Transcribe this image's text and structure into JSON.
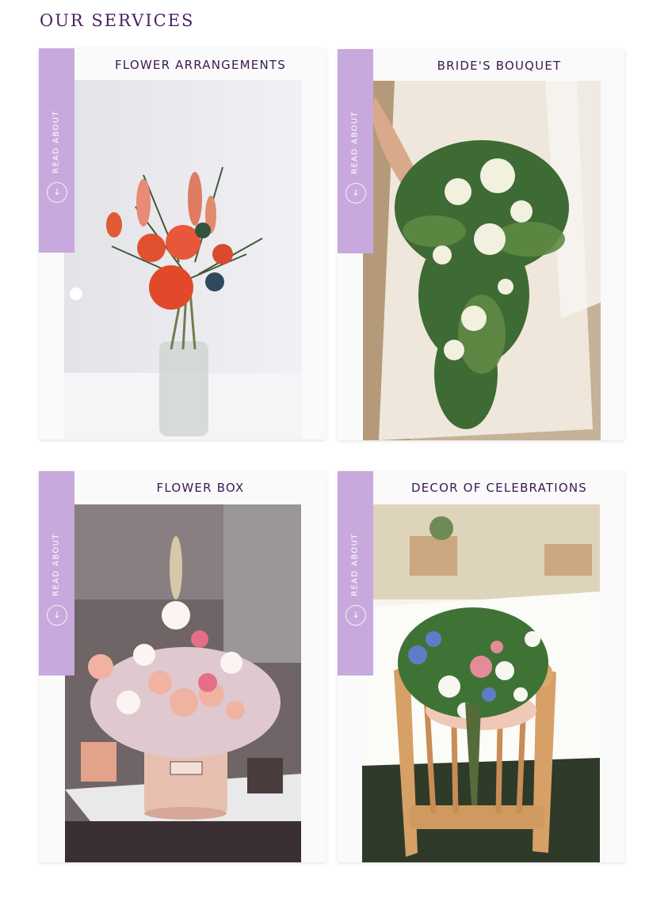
{
  "section": {
    "title": "OUR SERVICES"
  },
  "cards": [
    {
      "title": "FLOWER ARRANGEMENTS",
      "tab_label": "READ ABOUT",
      "icon": "arrow-down-icon"
    },
    {
      "title": "BRIDE'S BOUQUET",
      "tab_label": "READ ABOUT",
      "icon": "arrow-down-icon"
    },
    {
      "title": "FLOWER BOX",
      "tab_label": "READ ABOUT",
      "icon": "arrow-down-icon"
    },
    {
      "title": "DECOR OF CELEBRATIONS",
      "tab_label": "READ ABOUT",
      "icon": "arrow-down-icon"
    }
  ],
  "colors": {
    "accent": "#c8a9dd",
    "heading": "#4a1f63",
    "card_title": "#3b1a52",
    "card_bg": "#fbfafb"
  }
}
